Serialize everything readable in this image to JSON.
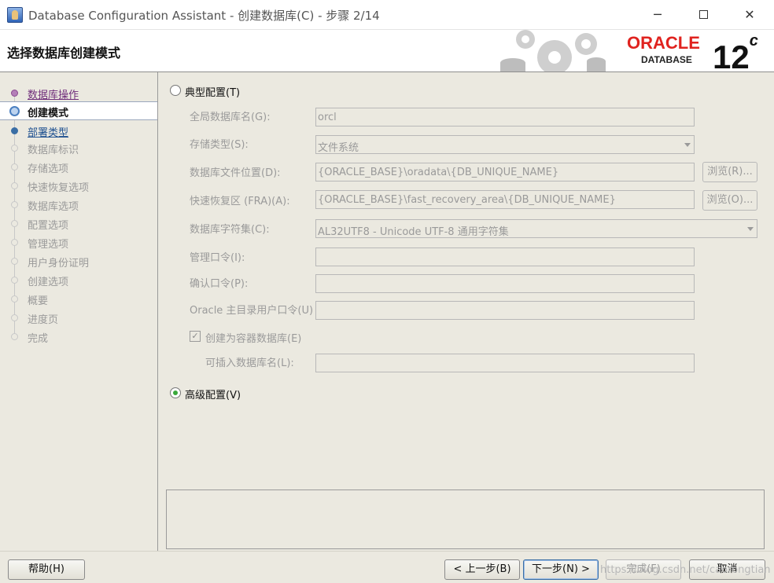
{
  "window": {
    "title": "Database Configuration Assistant - 创建数据库(C) - 步骤 2/14",
    "minimize_glyph": "─",
    "close_glyph": "✕"
  },
  "header": {
    "step_title": "选择数据库创建模式",
    "logo_brand": "ORACLE",
    "logo_sub": "DATABASE",
    "version": "12",
    "version_suffix": "c"
  },
  "steps": [
    {
      "label": "数据库操作",
      "state": "done"
    },
    {
      "label": "创建模式",
      "state": "current"
    },
    {
      "label": "部署类型",
      "state": "next"
    },
    {
      "label": "数据库标识",
      "state": "pending"
    },
    {
      "label": "存储选项",
      "state": "pending"
    },
    {
      "label": "快速恢复选项",
      "state": "pending"
    },
    {
      "label": "数据库选项",
      "state": "pending"
    },
    {
      "label": "配置选项",
      "state": "pending"
    },
    {
      "label": "管理选项",
      "state": "pending"
    },
    {
      "label": "用户身份证明",
      "state": "pending"
    },
    {
      "label": "创建选项",
      "state": "pending"
    },
    {
      "label": "概要",
      "state": "pending"
    },
    {
      "label": "进度页",
      "state": "pending"
    },
    {
      "label": "完成",
      "state": "pending"
    }
  ],
  "typical": {
    "radio_label": "典型配置(T)",
    "selected": false,
    "global_db_name_label": "全局数据库名(G):",
    "global_db_name_value": "orcl",
    "storage_type_label": "存储类型(S):",
    "storage_type_value": "文件系统",
    "db_file_location_label": "数据库文件位置(D):",
    "db_file_location_value": "{ORACLE_BASE}\\oradata\\{DB_UNIQUE_NAME}",
    "browse_r_label": "浏览(R)...",
    "fra_label": "快速恢复区 (FRA)(A):",
    "fra_value": "{ORACLE_BASE}\\fast_recovery_area\\{DB_UNIQUE_NAME}",
    "browse_o_label": "浏览(O)...",
    "charset_label": "数据库字符集(C):",
    "charset_value": "AL32UTF8 - Unicode UTF-8 通用字符集",
    "admin_password_label": "管理口令(I):",
    "confirm_password_label": "确认口令(P):",
    "oracle_home_password_label": "Oracle 主目录用户口令(U)",
    "container_db_label": "创建为容器数据库(E)",
    "container_db_checked": true,
    "pluggable_db_name_label": "可插入数据库名(L):"
  },
  "advanced": {
    "radio_label": "高级配置(V)",
    "selected": true
  },
  "footer": {
    "help_label": "帮助(H)",
    "back_label": "< 上一步(B)",
    "next_label": "下一步(N) >",
    "finish_label": "完成(F)",
    "cancel_label": "取消",
    "watermark": "https://blog.csdn.net/caorongtian"
  },
  "colors": {
    "oracle_red": "#e0231f",
    "selected_radio": "#3aa93a",
    "visited_step": "#6f2d7a",
    "next_step": "#1d4f8f"
  }
}
